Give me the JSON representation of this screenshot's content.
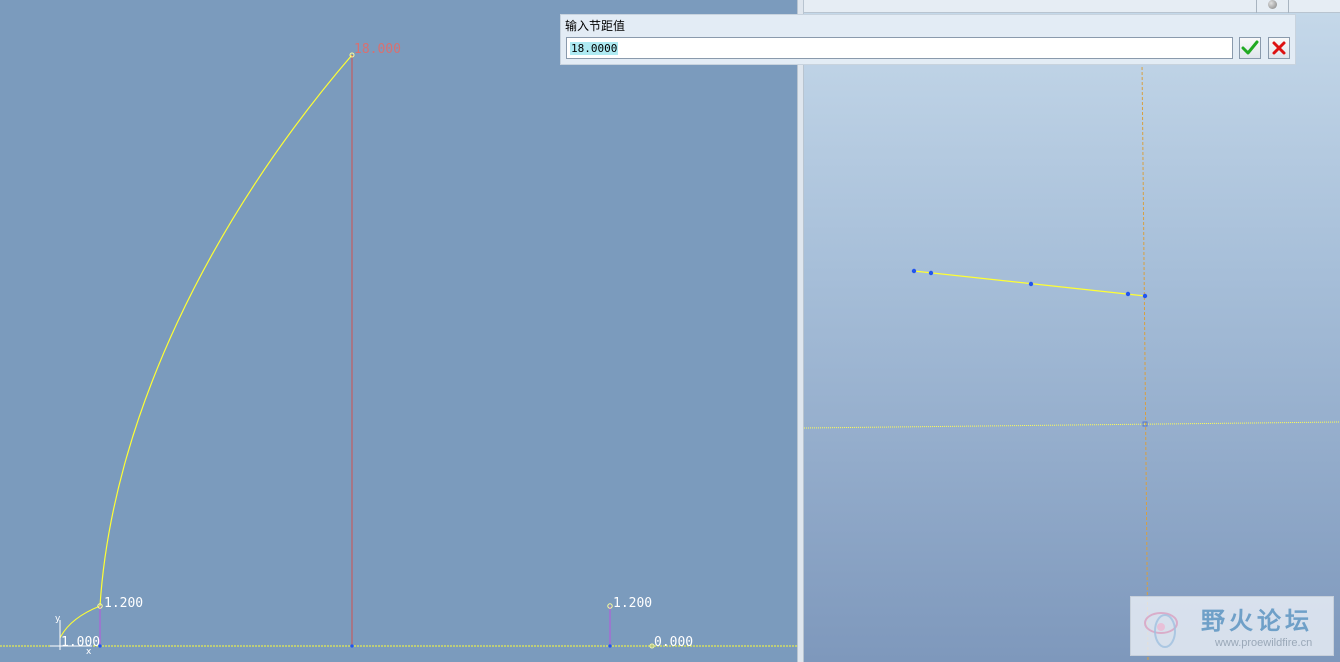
{
  "dialog": {
    "title": "输入节距值",
    "input_value": "18.0000",
    "ok_label": "accept",
    "cancel_label": "cancel"
  },
  "graph": {
    "label_top": "18.000",
    "label_left_low": "1.200",
    "label_right_low": "1.200",
    "label_origin": "1.000",
    "label_end": "0.000",
    "axis_y": "y",
    "axis_x": "x"
  },
  "watermark": {
    "title": "野火论坛",
    "url": "www.proewildfire.cn"
  },
  "colors": {
    "graph_bg": "#7b9bbd",
    "curve": "#ffff33",
    "vertical_top": "#d05050",
    "vertical_low": "#b060d8",
    "label_top": "#d97070",
    "label_white": "#ffffff",
    "point": "#2255ee"
  }
}
